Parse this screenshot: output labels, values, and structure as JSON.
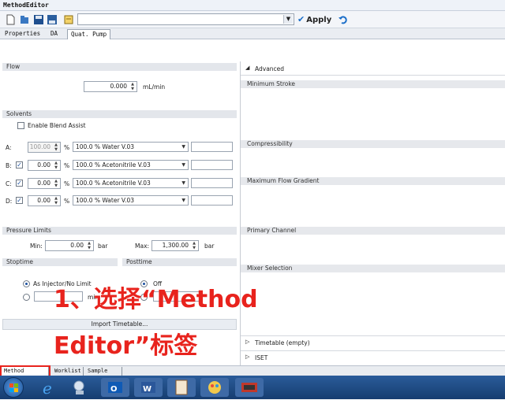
{
  "window": {
    "title": "MethodEditor"
  },
  "toolbar": {
    "apply_label": "Apply",
    "check_glyph": "✔"
  },
  "tabs": [
    "Properties",
    "DA",
    "Quat. Pump"
  ],
  "flow": {
    "header": "Flow",
    "value": "0.000",
    "unit": "mL/min"
  },
  "solvents": {
    "header": "Solvents",
    "blend_label": "Enable Blend Assist",
    "rows": [
      {
        "letter": "A:",
        "pct": "100.00",
        "solvent": "100.0 % Water V.03"
      },
      {
        "letter": "B:",
        "pct": "0.00",
        "solvent": "100.0 % Acetonitrile V.03"
      },
      {
        "letter": "C:",
        "pct": "0.00",
        "solvent": "100.0 % Acetonitrile V.03"
      },
      {
        "letter": "D:",
        "pct": "0.00",
        "solvent": "100.0 % Water V.03"
      }
    ],
    "pct_unit": "%"
  },
  "pressure": {
    "header": "Pressure Limits",
    "min_label": "Min:",
    "min_value": "0.00",
    "max_label": "Max:",
    "max_value": "1,300.00",
    "unit": "bar"
  },
  "stoptime": {
    "header": "Stoptime",
    "option1": "As Injector/No Limit",
    "unit": "min"
  },
  "posttime": {
    "header": "Posttime",
    "option1": "Off"
  },
  "import_label": "Import Timetable...",
  "advanced": {
    "header": "Advanced",
    "sections": [
      "Minimum Stroke",
      "Compressibility",
      "Maximum Flow Gradient",
      "Primary Channel",
      "Mixer Selection"
    ],
    "collapsed": [
      "Timetable (empty)",
      "ISET"
    ]
  },
  "bottom_tabs": [
    "Method Editor",
    "Worklist",
    "Sample Run"
  ],
  "annotation": {
    "line1": "1、选择“Method",
    "line2": "Editor”标签"
  },
  "colors": {
    "annotation": "#e8231d",
    "accent": "#1c6fc9"
  }
}
